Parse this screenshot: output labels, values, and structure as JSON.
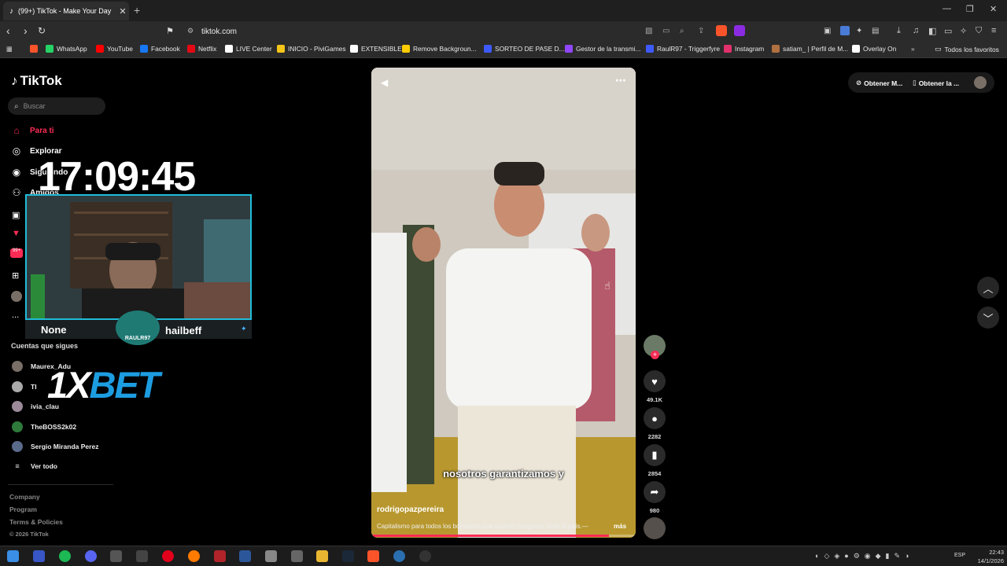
{
  "browser": {
    "tab_title": "(99+) TikTok - Make Your Day",
    "url": "tiktok.com",
    "bookmarks": [
      "WhatsApp",
      "YouTube",
      "Facebook",
      "Netflix",
      "LIVE Center",
      "INICIO - PiviGames",
      "EXTENSIBLE",
      "Remove Backgroun...",
      "SORTEO DE PASE D...",
      "Gestor de la transmi...",
      "RaulR97 - Triggerfyre",
      "Instagram",
      "satiam_ | Perfil de M...",
      "Overlay On"
    ],
    "bookmarks_folder": "Todos los favoritos",
    "bookmark_colors": [
      "#25d366",
      "#ff0000",
      "#1877f2",
      "#e50914",
      "#ffffff",
      "#f5c518",
      "#ffffff",
      "#ffcc00",
      "#3d5afe",
      "#9146ff",
      "#3d5afe",
      "#e1306c",
      "#b07040",
      "#ffffff"
    ]
  },
  "tiktok": {
    "logo": "TikTok",
    "search_placeholder": "Buscar",
    "nav": [
      "Para ti",
      "Explorar",
      "Siguiendo",
      "Amigos"
    ],
    "nav_more": "...",
    "following_title": "Cuentas que sigues",
    "following": [
      "Maurex_Adu",
      "TheBOSS2k02",
      "ivia_clau",
      "Sergio Miranda Perez"
    ],
    "following_partial": "TI",
    "see_all": "Ver todo",
    "footer": [
      "Company",
      "Program",
      "Terms & Policies",
      "© 2026 TikTok"
    ],
    "top_right": [
      "Obtener M...",
      "Obtener la ..."
    ]
  },
  "overlay": {
    "clock": "17:09:45",
    "name_left": "None",
    "name_right": "hailbeff",
    "badge": "RAULR97",
    "sponsor_a": "1X",
    "sponsor_b": "BET"
  },
  "video": {
    "caption": "nosotros garantizamos y",
    "author": "rodrigopazpereira",
    "description": "Capitalismo para todos los bolivianos que quieren progresar junto al país.—",
    "more": "más",
    "progress": 0.9,
    "likes": "49.1K",
    "comments": "2282",
    "saves": "2854",
    "shares": "980"
  },
  "taskbar": {
    "lang": "ESP",
    "time": "22:43",
    "date": "14/1/2026"
  }
}
